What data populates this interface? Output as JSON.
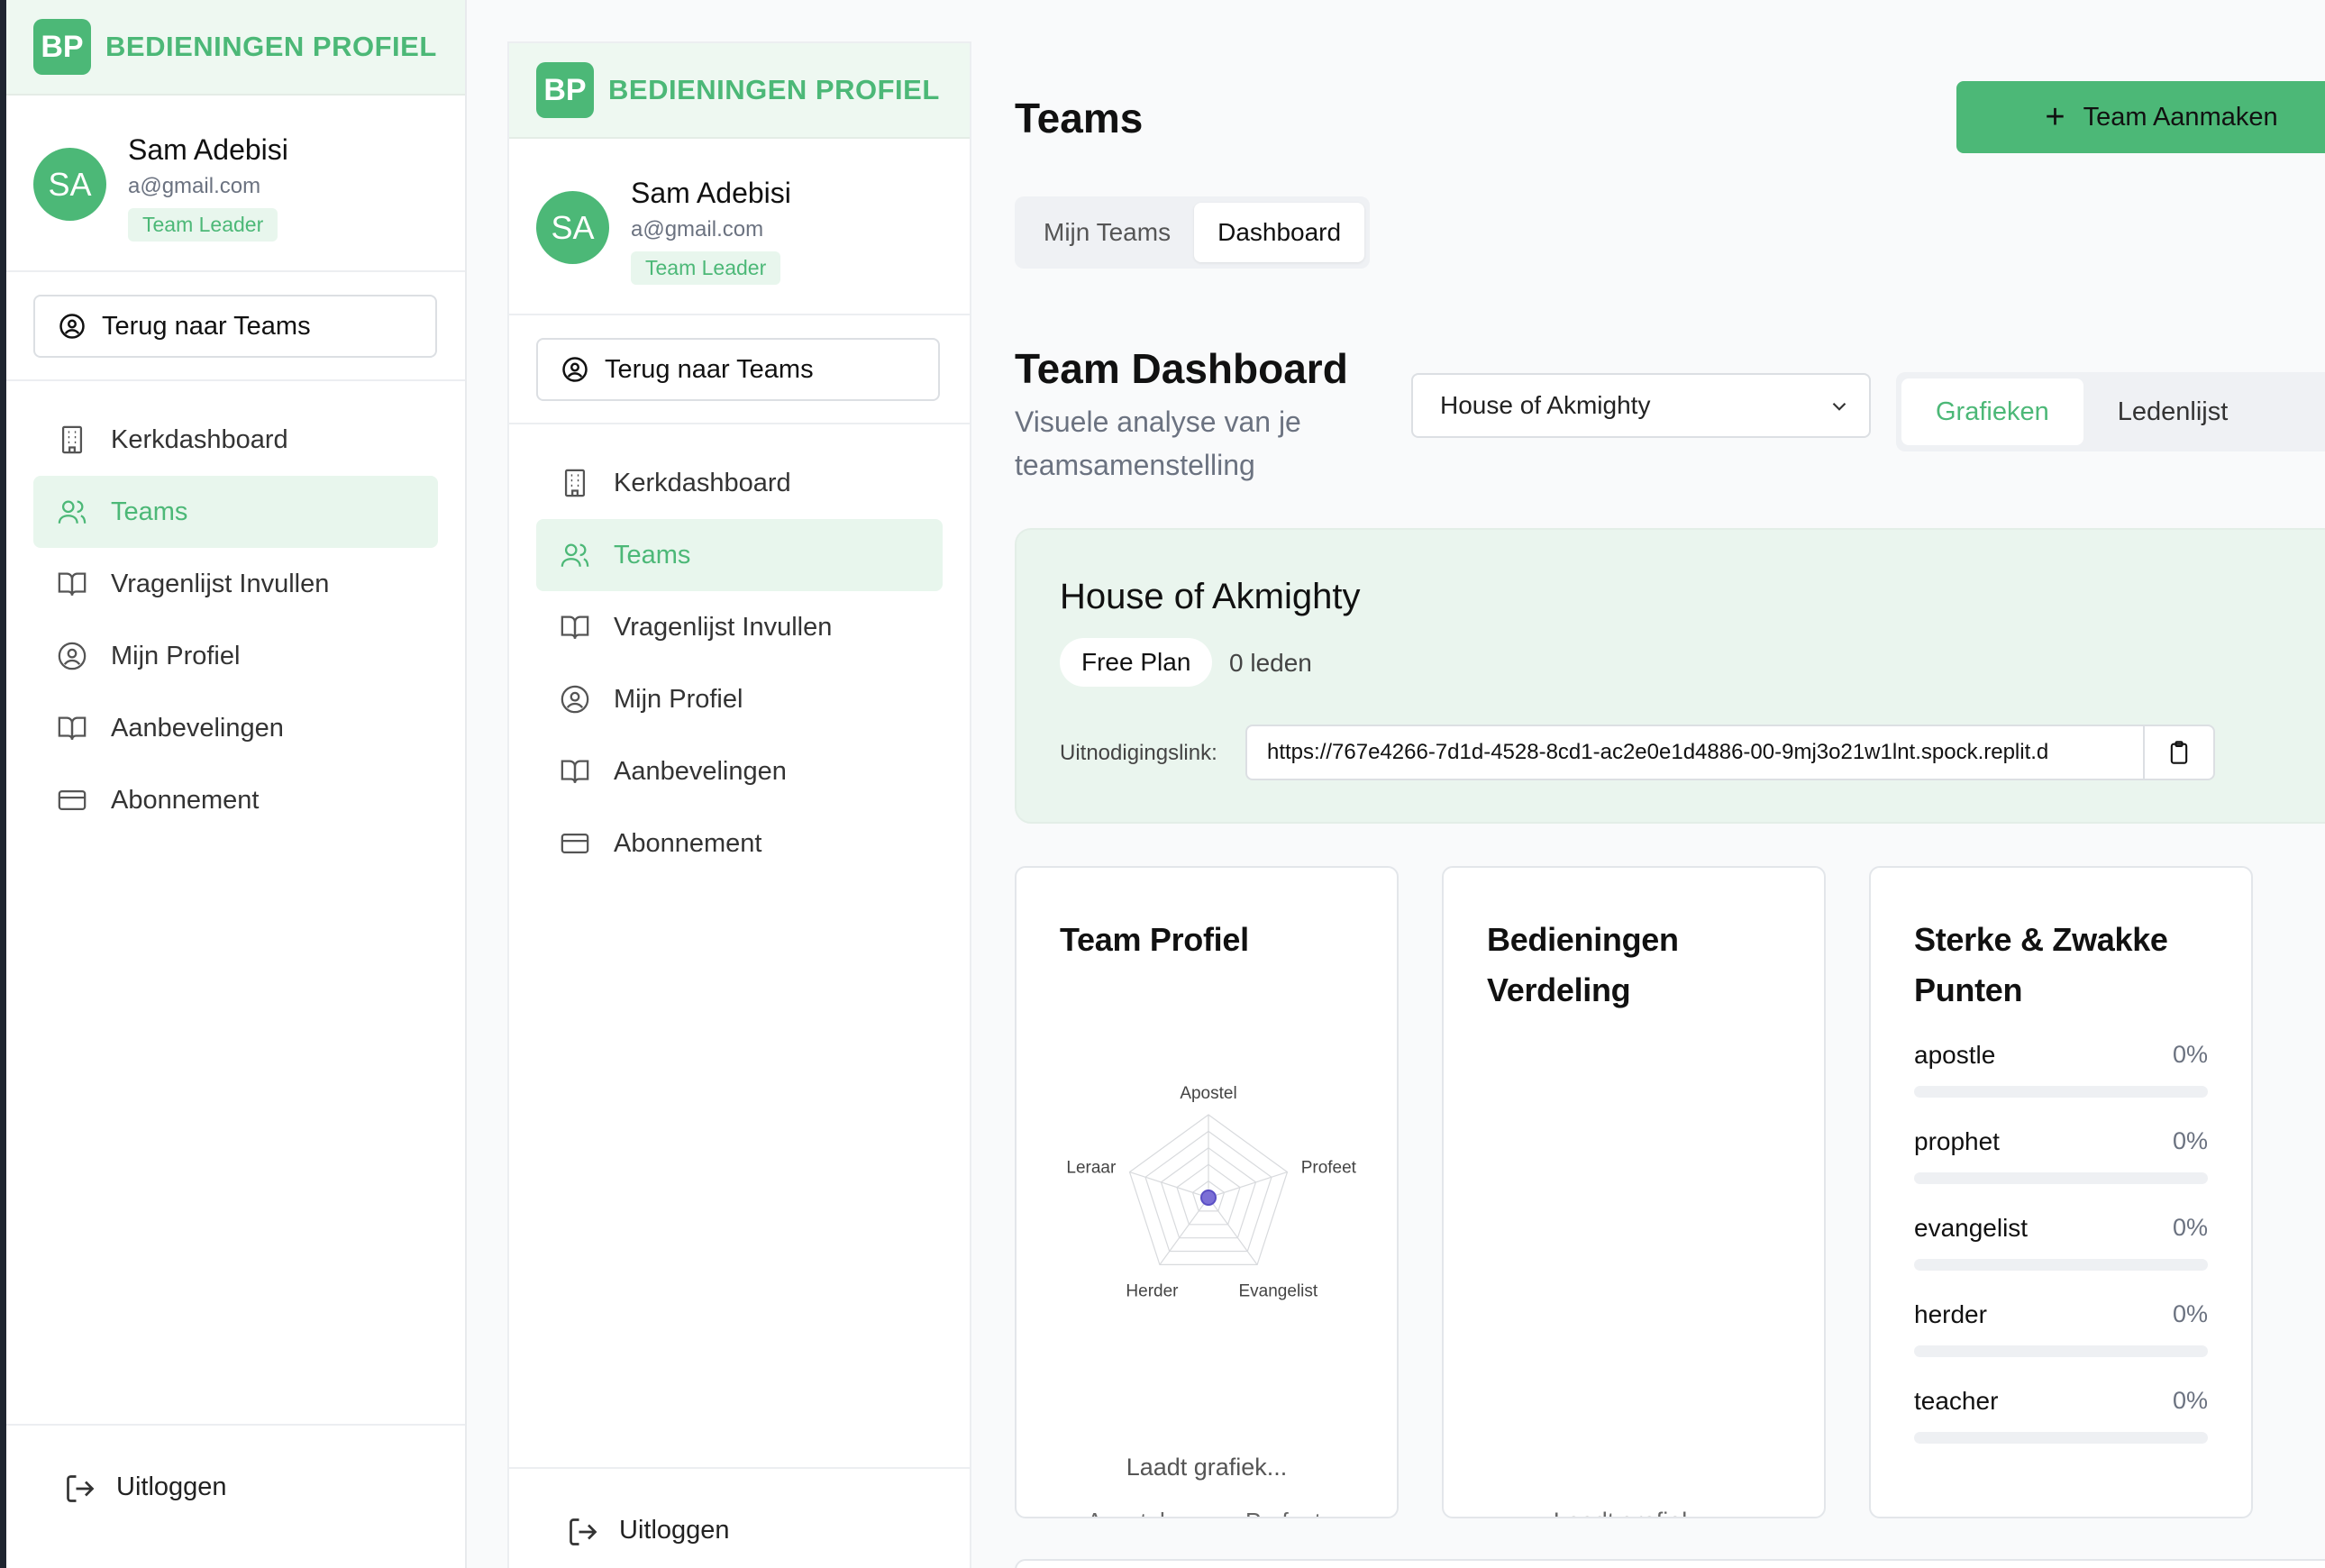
{
  "app": {
    "logo": "BP",
    "brand": "BEDIENINGEN PROFIEL"
  },
  "user": {
    "initials": "SA",
    "name": "Sam Adebisi",
    "email": "a@gmail.com",
    "role": "Team Leader"
  },
  "sidebar": {
    "back_label": "Terug naar Teams",
    "items": [
      {
        "label": "Kerkdashboard",
        "icon": "building-icon",
        "active": false
      },
      {
        "label": "Teams",
        "icon": "users-icon",
        "active": true
      },
      {
        "label": "Vragenlijst Invullen",
        "icon": "book-icon",
        "active": false
      },
      {
        "label": "Mijn Profiel",
        "icon": "user-circle-icon",
        "active": false
      },
      {
        "label": "Aanbevelingen",
        "icon": "book-icon",
        "active": false
      },
      {
        "label": "Abonnement",
        "icon": "credit-card-icon",
        "active": false
      }
    ],
    "logout_label": "Uitloggen"
  },
  "header": {
    "title": "Teams",
    "create_button": "Team Aanmaken",
    "tabs": [
      {
        "label": "Mijn Teams",
        "active": false
      },
      {
        "label": "Dashboard",
        "active": true
      }
    ]
  },
  "dashboard": {
    "title": "Team Dashboard",
    "subtitle": "Visuele analyse van je teamsamenstelling",
    "selected_team": "House of Akmighty",
    "view_tabs": [
      {
        "label": "Grafieken",
        "active": true
      },
      {
        "label": "Ledenlijst",
        "active": false
      }
    ]
  },
  "team_card": {
    "name": "House of Akmighty",
    "plan": "Free Plan",
    "members": "0 leden",
    "invite_label": "Uitnodigingslink:",
    "invite_link": "https://767e4266-7d1d-4528-8cd1-ac2e0e1d4886-00-9mj3o21w1lnt.spock.replit.d"
  },
  "cards": {
    "profile": {
      "title": "Team Profiel",
      "loading": "Laadt grafiek...",
      "cut_labels": [
        "Apostel",
        "Profeet"
      ]
    },
    "distribution": {
      "title": "Bedieningen Verdeling",
      "loading": "Laadt grafiek..."
    },
    "strengths": {
      "title": "Sterke & Zwakke Punten",
      "rows": [
        {
          "label": "apostle",
          "value": "0%",
          "fraction": 0
        },
        {
          "label": "prophet",
          "value": "0%",
          "fraction": 0
        },
        {
          "label": "evangelist",
          "value": "0%",
          "fraction": 0
        },
        {
          "label": "herder",
          "value": "0%",
          "fraction": 0
        },
        {
          "label": "teacher",
          "value": "0%",
          "fraction": 0
        }
      ]
    }
  },
  "chart_data": {
    "type": "radar",
    "categories": [
      "Apostel",
      "Profeet",
      "Evangelist",
      "Herder",
      "Leraar"
    ],
    "values": [
      0,
      0,
      0,
      0,
      0
    ]
  },
  "colors": {
    "accent": "#4cb877",
    "accent_light": "#e8f6ed",
    "radar_point": "#7b6fd6"
  }
}
